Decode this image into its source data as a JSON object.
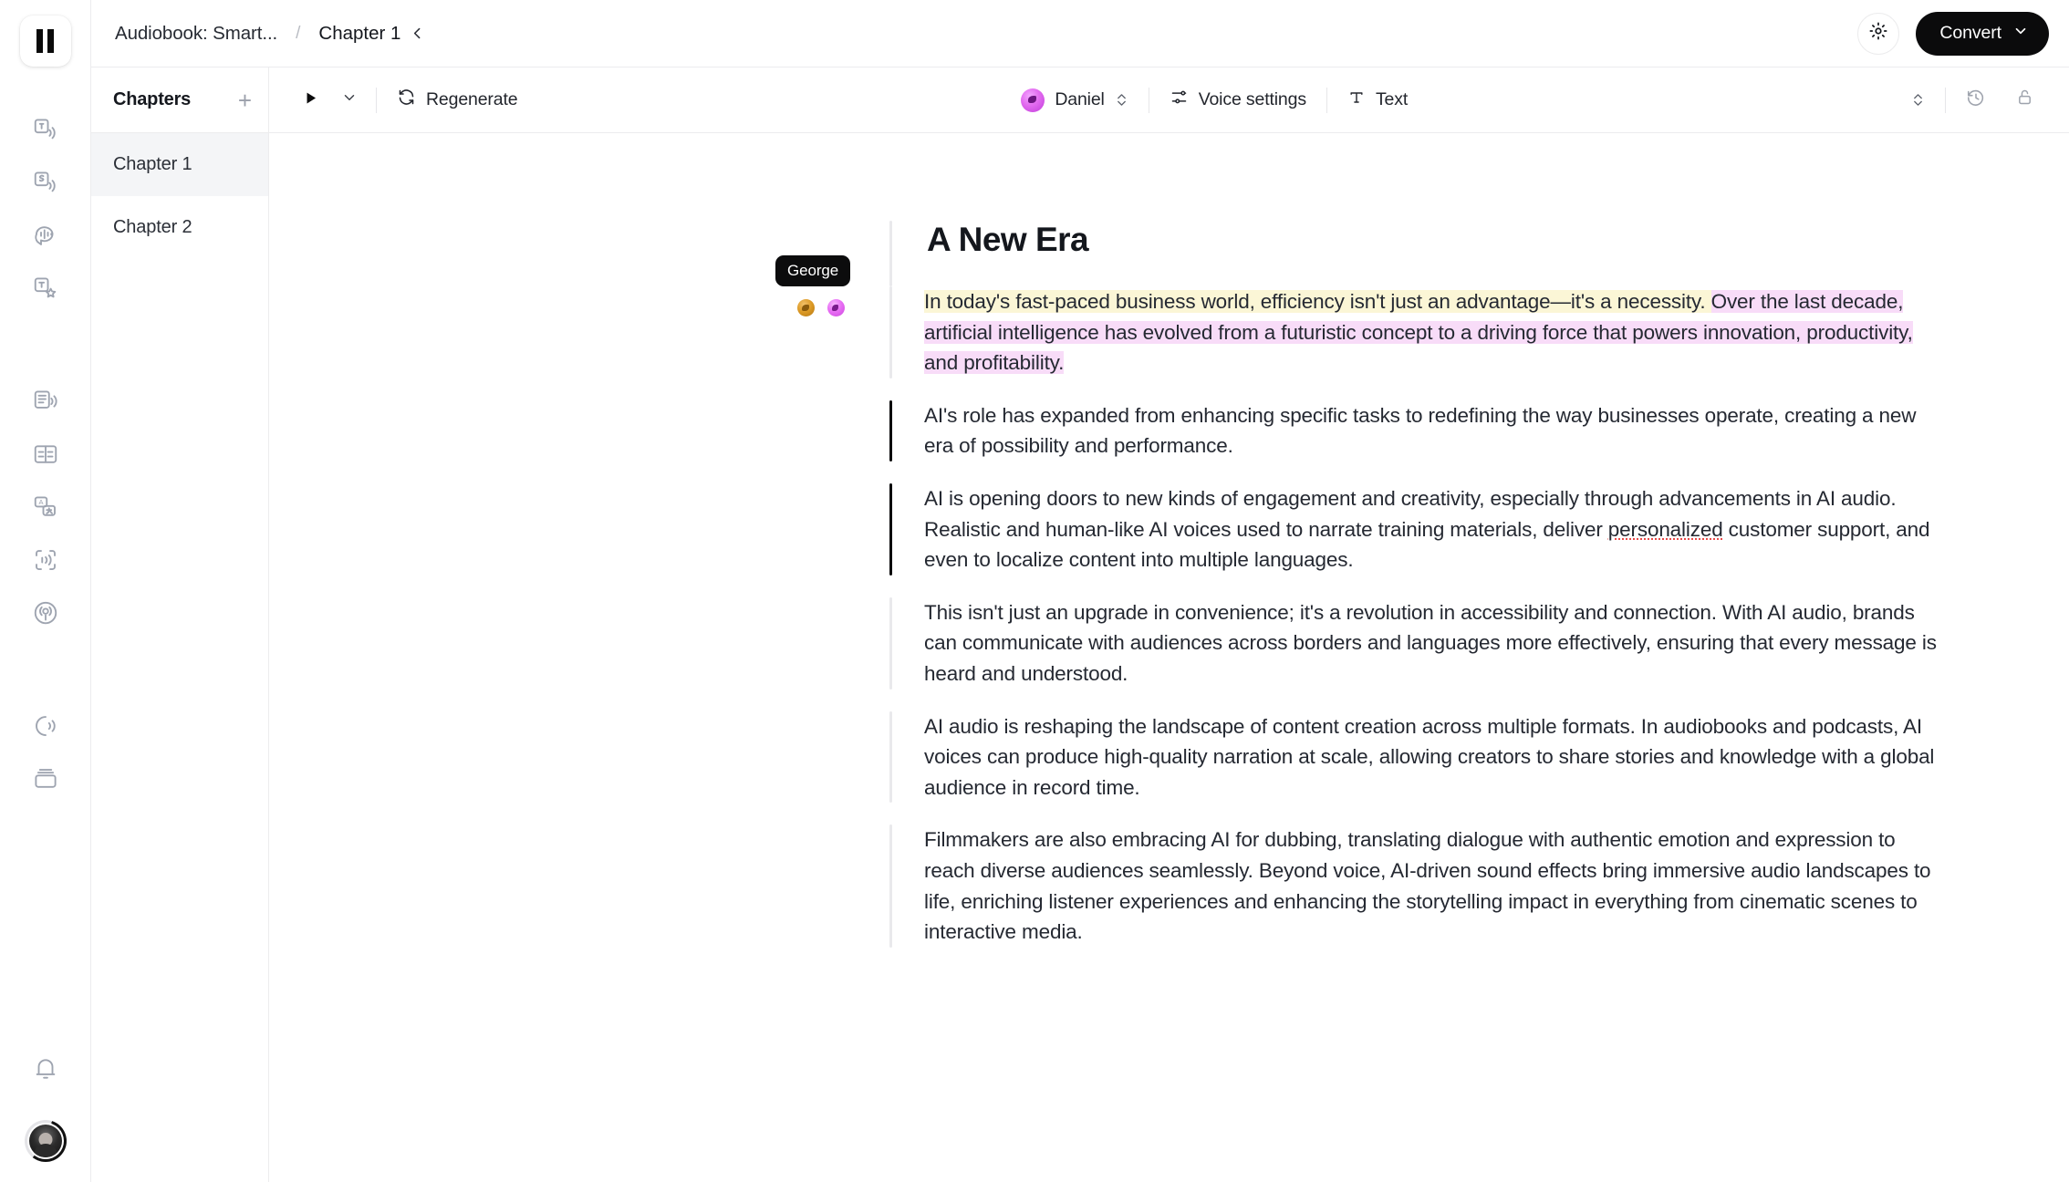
{
  "app": {
    "logo_icon": "pause-icon",
    "rail_items": [
      {
        "icon": "text-to-speech-icon",
        "name": "text-to-speech"
      },
      {
        "icon": "speech-to-speech-icon",
        "name": "speech-to-speech"
      },
      {
        "icon": "speech-to-text-icon",
        "name": "speech-to-text"
      },
      {
        "icon": "text-to-sfx-icon",
        "name": "sound-effects"
      },
      {
        "icon": "studio-icon",
        "name": "studio"
      },
      {
        "icon": "subtitles-icon",
        "name": "subtitles"
      },
      {
        "icon": "dubbing-icon",
        "name": "dubbing"
      },
      {
        "icon": "voice-isolator-icon",
        "name": "voice-isolator"
      },
      {
        "icon": "podcast-icon",
        "name": "podcast"
      },
      {
        "icon": "voices-icon",
        "name": "voices"
      },
      {
        "icon": "library-icon",
        "name": "library"
      }
    ],
    "notification_icon": "bell-icon",
    "user_avatar": "user-avatar"
  },
  "topbar": {
    "breadcrumb_project": "Audiobook: Smart...",
    "breadcrumb_separator": "/",
    "breadcrumb_current": "Chapter 1",
    "collapse_icon": "chevron-left-icon",
    "settings_icon": "gear-icon",
    "convert_label": "Convert",
    "convert_caret_icon": "chevron-down-icon"
  },
  "chapters": {
    "title": "Chapters",
    "add_icon": "plus-icon",
    "items": [
      {
        "label": "Chapter 1",
        "active": true
      },
      {
        "label": "Chapter 2",
        "active": false
      }
    ]
  },
  "toolbar": {
    "play_icon": "play-icon",
    "play_caret_icon": "chevron-down-icon",
    "regenerate_icon": "refresh-icon",
    "regenerate_label": "Regenerate",
    "voice_name": "Daniel",
    "voice_avatar_icon": "voice-avatar-icon",
    "voice_stepper_icon": "chevron-up-down-icon",
    "voice_settings_icon": "sliders-icon",
    "voice_settings_label": "Voice settings",
    "text_icon": "text-format-icon",
    "text_label": "Text",
    "text_stepper_icon": "chevron-up-down-icon",
    "history_icon": "history-icon",
    "lock_icon": "unlock-icon"
  },
  "document": {
    "title": "A New Era",
    "speaker_tooltip": "George",
    "speaker_dots": [
      {
        "name": "voice-dot-gold",
        "color": "#dc9a25"
      },
      {
        "name": "voice-dot-pink",
        "color": "#e86ef4"
      }
    ],
    "highlight_colors": {
      "yellow": "#fbf6d6",
      "pink": "#f8dcf8"
    },
    "paragraphs": [
      {
        "id": "para-1",
        "active": false,
        "segments": [
          {
            "text": "In today's fast-paced business world, efficiency isn't just an advantage—it's a necessity. ",
            "highlight": "yellow"
          },
          {
            "text": "Over the last decade, artificial intelligence has evolved from a futuristic concept to a driving force that powers innovation, productivity, and profitability.",
            "highlight": "pink"
          }
        ]
      },
      {
        "id": "para-2",
        "active": true,
        "segments": [
          {
            "text": "AI's role has expanded from enhancing specific tasks to redefining the way businesses operate, creating a new era of possibility and performance.",
            "highlight": "none"
          }
        ]
      },
      {
        "id": "para-3",
        "active": true,
        "segments": [
          {
            "text": "AI is opening doors to new kinds of engagement and creativity, especially through advancements in AI audio. Realistic and human-like AI voices used to narrate training materials, deliver ",
            "highlight": "none"
          },
          {
            "text": "personalized",
            "highlight": "none",
            "spellcheck": true
          },
          {
            "text": " customer support, and even to localize content into multiple languages.",
            "highlight": "none"
          }
        ]
      },
      {
        "id": "para-4",
        "active": false,
        "segments": [
          {
            "text": "This isn't just an upgrade in convenience; it's a revolution in accessibility and connection. With AI audio, brands can communicate with audiences across borders and languages more effectively, ensuring that every message is heard and understood.",
            "highlight": "none"
          }
        ]
      },
      {
        "id": "para-5",
        "active": false,
        "segments": [
          {
            "text": "AI audio is reshaping the landscape of content creation across multiple formats. In audiobooks and podcasts, AI voices can produce high-quality narration at scale, allowing creators to share stories and knowledge with a global audience in record time.",
            "highlight": "none"
          }
        ]
      },
      {
        "id": "para-6",
        "active": false,
        "segments": [
          {
            "text": "Filmmakers are also embracing AI for dubbing, translating dialogue with authentic emotion and expression to reach diverse audiences seamlessly. Beyond voice, AI-driven sound effects bring immersive audio landscapes to life, enriching listener experiences and enhancing the storytelling impact in everything from cinematic scenes to interactive media.",
            "highlight": "none"
          }
        ]
      }
    ]
  }
}
